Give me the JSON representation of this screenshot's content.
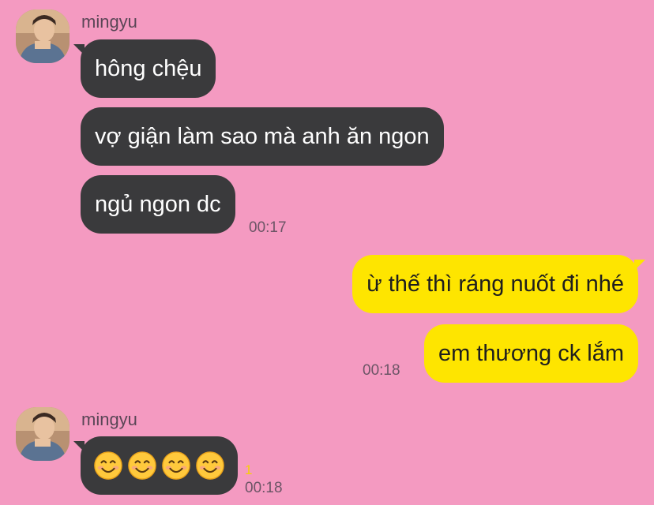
{
  "chat": {
    "groups": [
      {
        "sender": "mingyu",
        "messages": [
          "hông chệu",
          "vợ giận làm sao mà anh ăn ngon",
          "ngủ ngon dc"
        ],
        "time": "00:17"
      },
      {
        "sender": "me",
        "messages": [
          "ừ thế thì ráng nuốt đi nhé",
          "em thương ck lắm"
        ],
        "time": "00:18"
      },
      {
        "sender": "mingyu",
        "messages": [
          "😊😊😊😊"
        ],
        "emoji": "smiling-face-with-smiling-eyes",
        "unread_count": "1",
        "time": "00:18"
      }
    ]
  },
  "colors": {
    "background": "#f49ac1",
    "incoming_bubble": "#3a3a3c",
    "outgoing_bubble": "#fee500",
    "unread": "#f7d100"
  }
}
